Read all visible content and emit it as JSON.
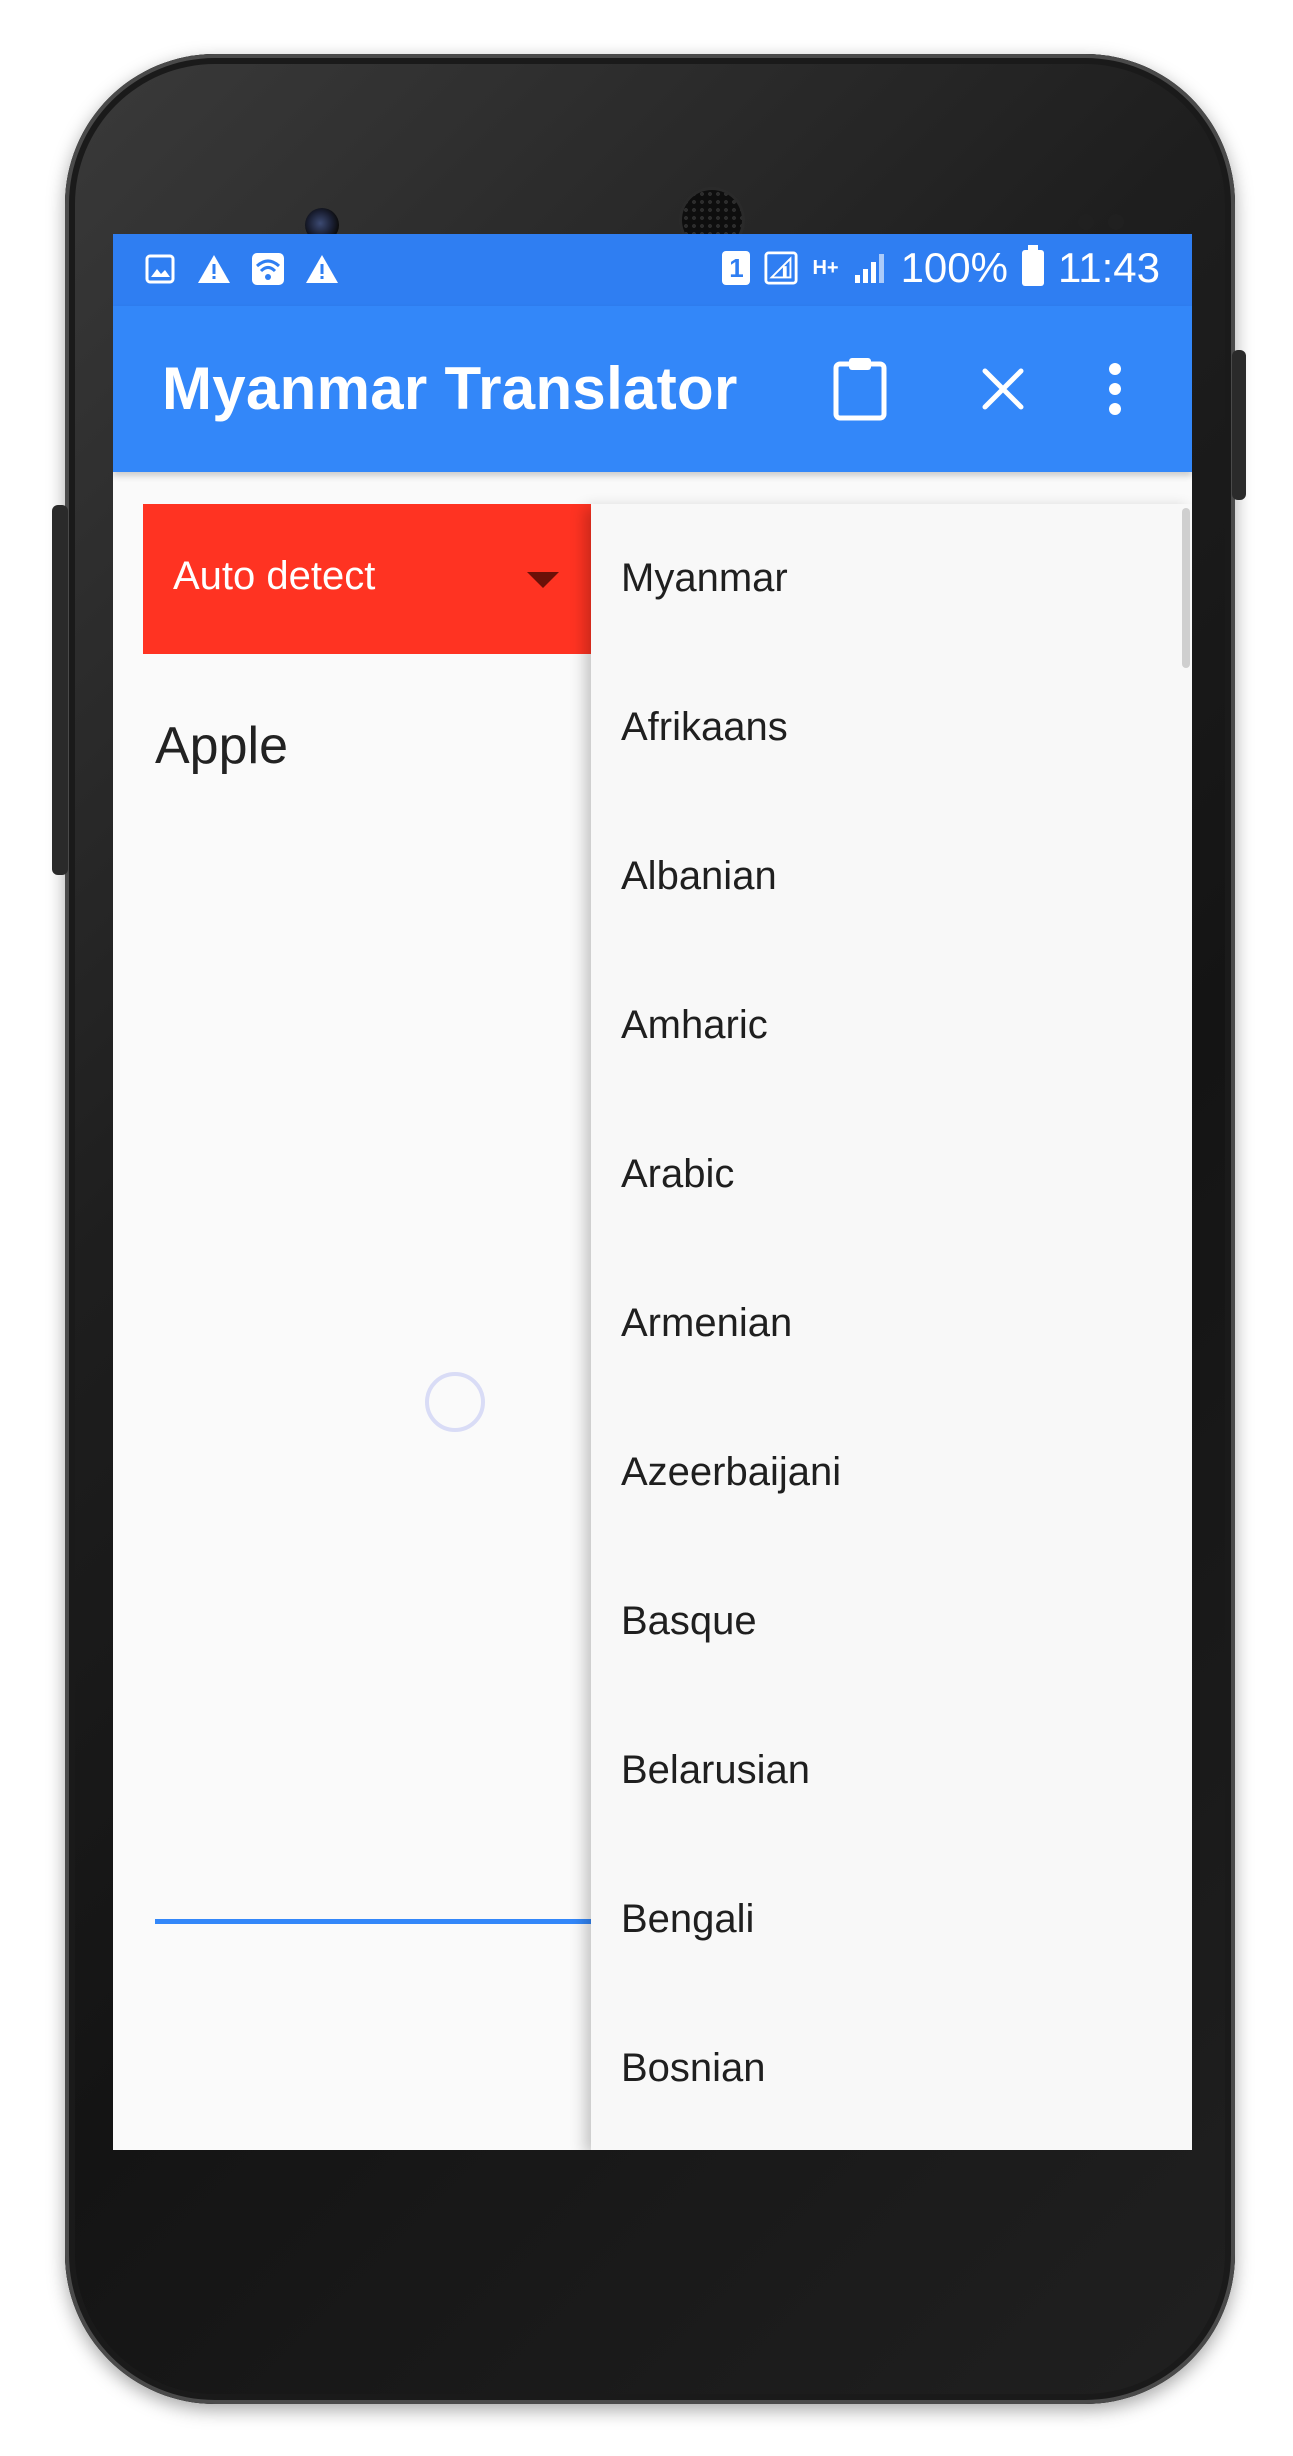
{
  "status_bar": {
    "sim_label": "1",
    "network": "H+",
    "battery_pct": "100%",
    "time": "11:43",
    "icons": [
      "image-icon",
      "warning-icon",
      "wifi-icon",
      "warning-icon"
    ]
  },
  "app_bar": {
    "title": "Myanmar Translator",
    "actions": [
      "clipboard-icon",
      "close-icon",
      "more-vert-icon"
    ]
  },
  "source_lang": {
    "selected": "Auto detect"
  },
  "input": {
    "value": "Apple"
  },
  "dropdown": {
    "items": [
      "Myanmar",
      "Afrikaans",
      "Albanian",
      "Amharic",
      "Arabic",
      "Armenian",
      "Azeerbaijani",
      "Basque",
      "Belarusian",
      "Bengali",
      "Bosnian"
    ]
  },
  "colors": {
    "status_bar": "#2f7ef2",
    "app_bar": "#3387f9",
    "spinner_bg": "#ff3322",
    "accent": "#3387f9"
  }
}
